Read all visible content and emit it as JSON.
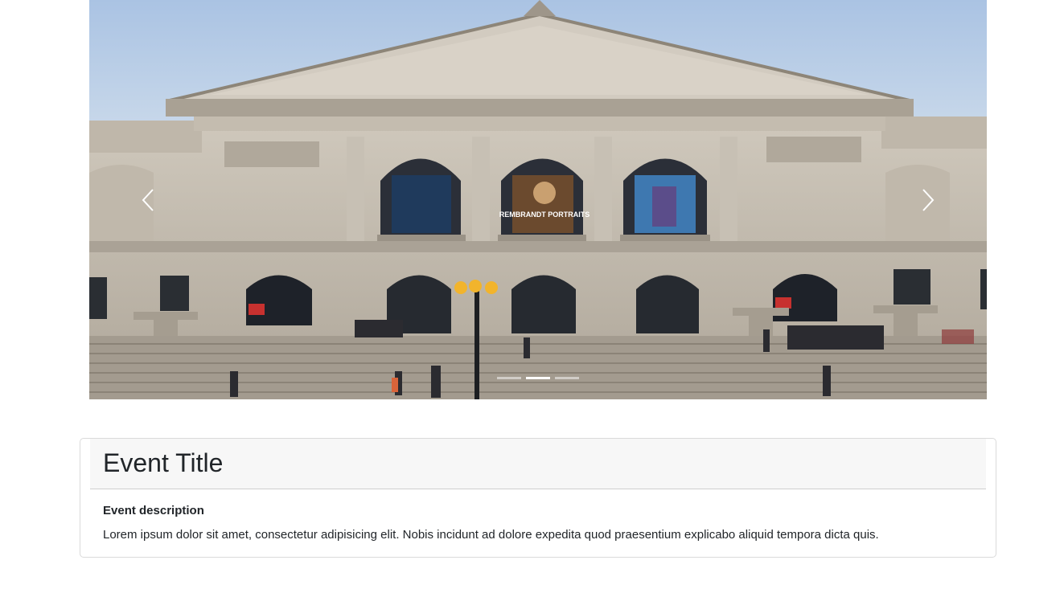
{
  "carousel": {
    "slide_image": "art-institute-building-photo",
    "indicator_count": 3,
    "active_indicator": 2,
    "prev_icon": "chevron-left-icon",
    "next_icon": "chevron-right-icon",
    "banners": {
      "center": "REMBRANDT PORTRAITS"
    }
  },
  "event": {
    "title": "Event Title",
    "description_heading": "Event description",
    "description_text": "Lorem ipsum dolor sit amet, consectetur adipisicing elit. Nobis incidunt ad dolore expedita quod praesentium explicabo aliquid tempora dicta quis."
  },
  "colors": {
    "card_header_bg": "#f7f7f7",
    "card_border": "#dadada",
    "text": "#212529"
  }
}
